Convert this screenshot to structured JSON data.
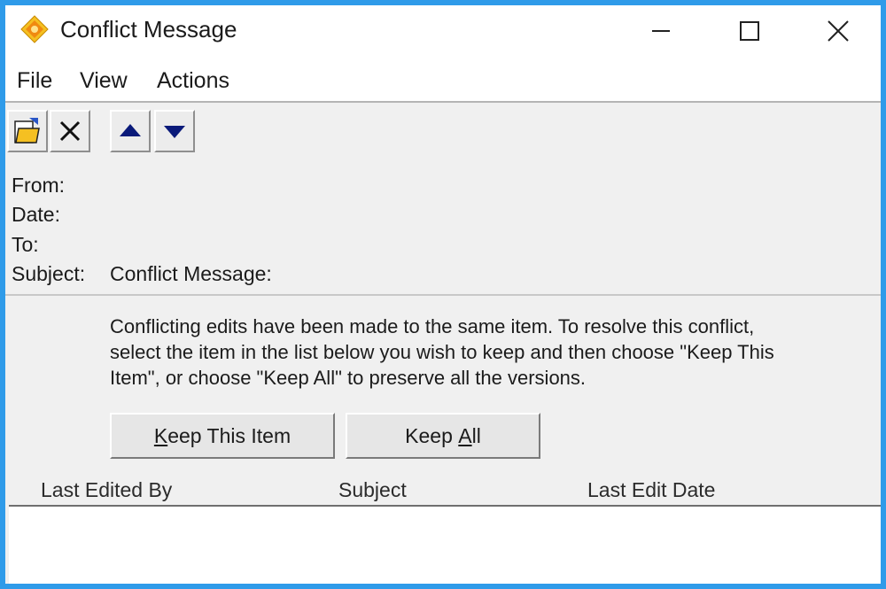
{
  "window": {
    "title": "Conflict Message",
    "icon": "diamond-app-icon"
  },
  "menu": {
    "items": [
      "File",
      "View",
      "Actions"
    ]
  },
  "toolbar": {
    "icons": [
      "open-document-icon",
      "delete-x-icon",
      "up-arrow-icon",
      "down-arrow-icon"
    ]
  },
  "header": {
    "from_label": "From:",
    "date_label": "Date:",
    "to_label": "To:",
    "subject_label": "Subject:",
    "subject_value": "Conflict Message:"
  },
  "message": {
    "line1": "Conflicting edits have been made to the same item. To resolve this conflict,",
    "line2": "select the item in the list below you wish to keep and then choose \"Keep This",
    "line3": "Item\", or choose \"Keep All\" to preserve all the versions."
  },
  "buttons": {
    "keep_this_prefix": "",
    "keep_this_accel": "K",
    "keep_this_rest": "eep This Item",
    "keep_all_prefix": "Keep ",
    "keep_all_accel": "A",
    "keep_all_rest": "ll"
  },
  "list": {
    "columns": [
      "Last Edited By",
      "Subject",
      "Last Edit Date"
    ],
    "rows": []
  },
  "colors": {
    "frame": "#2f9be9",
    "window_bg": "#f0f0f0",
    "arrow": "#0a1a7a",
    "icon_yellow": "#f5c022"
  }
}
